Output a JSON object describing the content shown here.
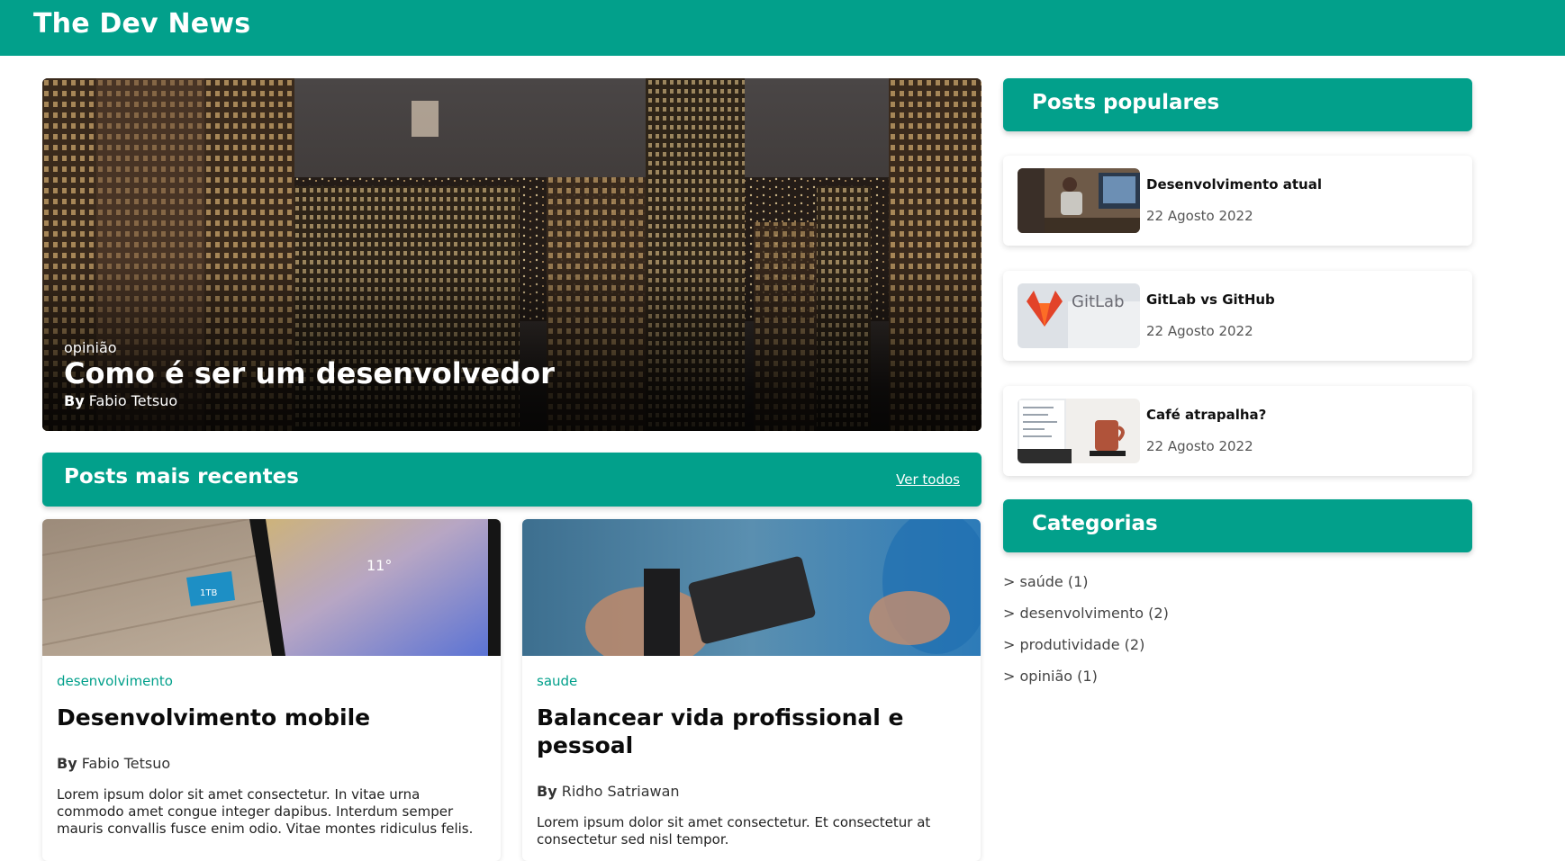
{
  "site": {
    "title": "The Dev News",
    "brand_color": "#02a08b"
  },
  "hero": {
    "category": "opinião",
    "title": "Como é ser um desenvolvedor",
    "by_label": "By",
    "author": "Fabio Tetsuo"
  },
  "recent": {
    "heading": "Posts mais recentes",
    "see_all": "Ver todos",
    "posts": [
      {
        "category": "desenvolvimento",
        "title": "Desenvolvimento mobile",
        "by_label": "By",
        "author": "Fabio Tetsuo",
        "excerpt": "Lorem ipsum dolor sit amet consectetur. In vitae urna commodo amet congue integer dapibus. Interdum semper mauris convallis fusce enim odio. Vitae montes ridiculus felis."
      },
      {
        "category": "saude",
        "title": "Balancear vida profissional e pessoal",
        "by_label": "By",
        "author": "Ridho Satriawan",
        "excerpt": "Lorem ipsum dolor sit amet consectetur. Et consectetur at consectetur sed nisl tempor."
      }
    ]
  },
  "popular": {
    "heading": "Posts populares",
    "items": [
      {
        "title": "Desenvolvimento atual",
        "date": "22 Agosto 2022"
      },
      {
        "title": "GitLab vs GitHub",
        "date": "22 Agosto 2022",
        "logo_text": "GitLab"
      },
      {
        "title": "Café atrapalha?",
        "date": "22 Agosto 2022"
      }
    ]
  },
  "categories": {
    "heading": "Categorias",
    "items": [
      "> saúde (1)",
      "> desenvolvimento (2)",
      "> produtividade (2)",
      "> opinião (1)"
    ]
  },
  "thumb_text": {
    "phone_temp": "11°",
    "sd_card": "1TB"
  }
}
